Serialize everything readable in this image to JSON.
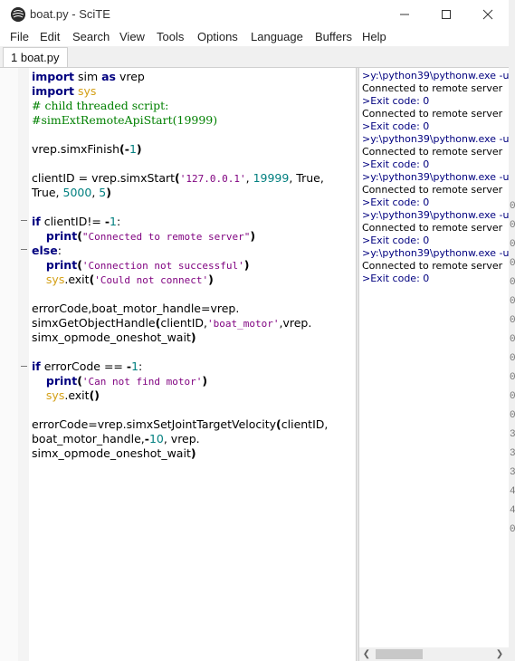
{
  "window": {
    "title": "boat.py - SciTE",
    "app_icon": "scite-logo-icon",
    "buttons": {
      "minimize": "minimize-icon",
      "maximize": "maximize-icon",
      "close": "close-icon"
    }
  },
  "menu": {
    "items": [
      "File",
      "Edit",
      "Search",
      "View",
      "Tools",
      "Options",
      "Language",
      "Buffers",
      "Help"
    ]
  },
  "tabs": [
    {
      "label": "1 boat.py",
      "active": true
    }
  ],
  "editor": {
    "lines": [
      "import sim as vrep",
      "import sys",
      "# child threaded script:",
      "#simExtRemoteApiStart(19999)",
      "",
      "vrep.simxFinish(-1)",
      "",
      "clientID = vrep.simxStart('127.0.0.1', 19999, True,",
      "True, 5000, 5)",
      "",
      "if clientID!= -1:",
      "    print(\"Connected to remote server\")",
      "else:",
      "    print('Connection not successful')",
      "    sys.exit('Could not connect')",
      "",
      "errorCode,boat_motor_handle=vrep.",
      "simxGetObjectHandle(clientID,'boat_motor',vrep.",
      "simx_opmode_oneshot_wait)",
      "",
      "if errorCode == -1:",
      "    print('Can not find motor')",
      "    sys.exit()",
      "",
      "errorCode=vrep.simxSetJointTargetVelocity(clientID,",
      "boat_motor_handle,-10, vrep.",
      "simx_opmode_oneshot_wait)"
    ]
  },
  "output": {
    "lines": [
      ">y:\\python39\\pythonw.exe -u",
      "Connected to remote server",
      ">Exit code: 0",
      "Connected to remote server",
      ">Exit code: 0",
      ">y:\\python39\\pythonw.exe -u",
      "Connected to remote server",
      ">Exit code: 0",
      ">y:\\python39\\pythonw.exe -u",
      "Connected to remote server",
      ">Exit code: 0",
      ">y:\\python39\\pythonw.exe -u",
      "Connected to remote server",
      ">Exit code: 0",
      ">y:\\python39\\pythonw.exe -u",
      "Connected to remote server",
      ">Exit code: 0"
    ]
  },
  "right_edge_digits": [
    "0",
    "0",
    "0",
    "0",
    "0",
    "0",
    "0",
    "0",
    "0",
    "0",
    "0",
    "0",
    "3",
    "3",
    "3",
    "4",
    "4",
    "0"
  ],
  "colors": {
    "keyword": "#00007f",
    "module": "#d4a017",
    "comment": "#008000",
    "string": "#7f007f",
    "number": "#007f7f",
    "output_command": "#00007f"
  }
}
